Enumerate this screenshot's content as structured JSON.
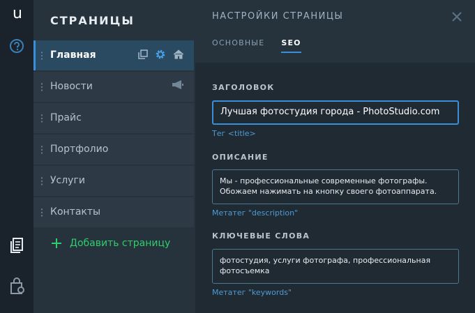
{
  "app": {
    "logo": "u"
  },
  "pages_panel": {
    "title": "СТРАНИЦЫ",
    "items": [
      {
        "label": "Главная",
        "active": true
      },
      {
        "label": "Новости",
        "active": false
      },
      {
        "label": "Прайс",
        "active": false
      },
      {
        "label": "Портфолио",
        "active": false
      },
      {
        "label": "Услуги",
        "active": false
      },
      {
        "label": "Контакты",
        "active": false
      }
    ],
    "add_label": "Добавить страницу"
  },
  "settings": {
    "title": "НАСТРОЙКИ СТРАНИЦЫ",
    "tabs": [
      {
        "label": "ОСНОВНЫЕ",
        "active": false
      },
      {
        "label": "SEO",
        "active": true
      }
    ],
    "title_field": {
      "label": "ЗАГОЛОВОК",
      "value": "Лучшая фотостудия города - PhotoStudio.com",
      "hint": "Тег <title>"
    },
    "description_field": {
      "label": "ОПИСАНИЕ",
      "value": "Мы - профессиональные современные фотографы. Обожаем нажимать на кнопку своего фотоаппарата.",
      "hint": "Метатег \"description\""
    },
    "keywords_field": {
      "label": "КЛЮЧЕВЫЕ СЛОВА",
      "value": "фотостудия, услуги фотографа, профессиональная фотосъемка",
      "hint": "Метатег \"keywords\""
    }
  },
  "icons": {
    "rail": [
      "help-icon",
      "pages-icon",
      "shopping-bag-icon"
    ],
    "page_tools": [
      "copy-icon",
      "gear-icon",
      "home-icon",
      "megaphone-icon"
    ],
    "close": "close-icon"
  },
  "colors": {
    "accent": "#3a8fd8",
    "add": "#2ecf6a",
    "hint": "#4f9bd6"
  }
}
